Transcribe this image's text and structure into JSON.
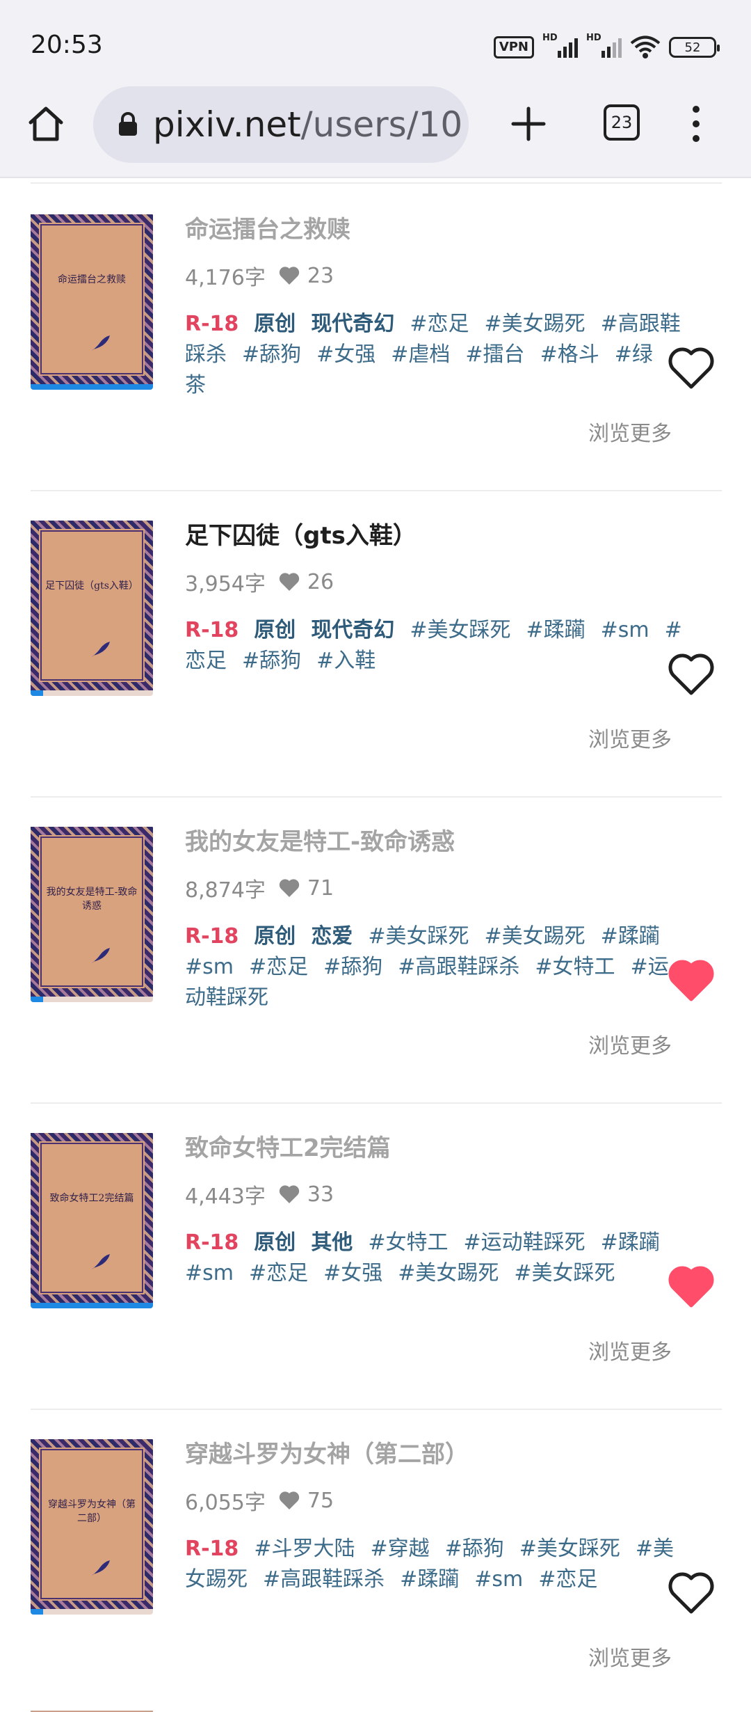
{
  "status": {
    "time": "20:53",
    "vpn": "VPN",
    "signal_label": "HD",
    "battery": "52"
  },
  "browser": {
    "url_host": "pixiv.net",
    "url_path": "/users/10",
    "tab_count": "23"
  },
  "items": [
    {
      "cover_title": "命运擂台之救赎",
      "title": "命运擂台之救赎",
      "read": false,
      "chars": "4,176字",
      "likes": "23",
      "progress": 1.0,
      "tags": [
        "R-18",
        "原创",
        "现代奇幻",
        "#恋足",
        "#美女踢死",
        "#高跟鞋踩杀",
        "#舔狗",
        "#女强",
        "#虐档",
        "#擂台",
        "#格斗",
        "#绿茶"
      ],
      "more": "浏览更多",
      "liked": false
    },
    {
      "cover_title": "足下囚徒（gts入鞋）",
      "title": "足下囚徒（gts入鞋）",
      "read": true,
      "chars": "3,954字",
      "likes": "26",
      "progress": 0.1,
      "tags": [
        "R-18",
        "原创",
        "现代奇幻",
        "#美女踩死",
        "#蹂躏",
        "#sm",
        "#恋足",
        "#舔狗",
        "#入鞋"
      ],
      "more": "浏览更多",
      "liked": false
    },
    {
      "cover_title": "我的女友是特工-致命诱惑",
      "title": "我的女友是特工-致命诱惑",
      "read": false,
      "chars": "8,874字",
      "likes": "71",
      "progress": 0.1,
      "tags": [
        "R-18",
        "原创",
        "恋爱",
        "#美女踩死",
        "#美女踢死",
        "#蹂躏",
        "#sm",
        "#恋足",
        "#舔狗",
        "#高跟鞋踩杀",
        "#女特工",
        "#运动鞋踩死"
      ],
      "more": "浏览更多",
      "liked": true
    },
    {
      "cover_title": "致命女特工2完结篇",
      "title": "致命女特工2完结篇",
      "read": false,
      "chars": "4,443字",
      "likes": "33",
      "progress": 1.0,
      "tags": [
        "R-18",
        "原创",
        "其他",
        "#女特工",
        "#运动鞋踩死",
        "#蹂躏",
        "#sm",
        "#恋足",
        "#女强",
        "#美女踢死",
        "#美女踩死"
      ],
      "more": "浏览更多",
      "liked": true
    },
    {
      "cover_title": "穿越斗罗为女神（第二部）",
      "title": "穿越斗罗为女神（第二部）",
      "read": false,
      "chars": "6,055字",
      "likes": "75",
      "progress": 0.1,
      "tags": [
        "R-18",
        "#斗罗大陆",
        "#穿越",
        "#舔狗",
        "#美女踩死",
        "#美女踢死",
        "#高跟鞋踩杀",
        "#蹂躏",
        "#sm",
        "#恋足"
      ],
      "more": "浏览更多",
      "liked": false
    }
  ],
  "colors": {
    "liked_heart": "#ff4d6a",
    "r18": "#e2435e",
    "tag": "#3d6b8a",
    "progress": "#1e88e5"
  }
}
